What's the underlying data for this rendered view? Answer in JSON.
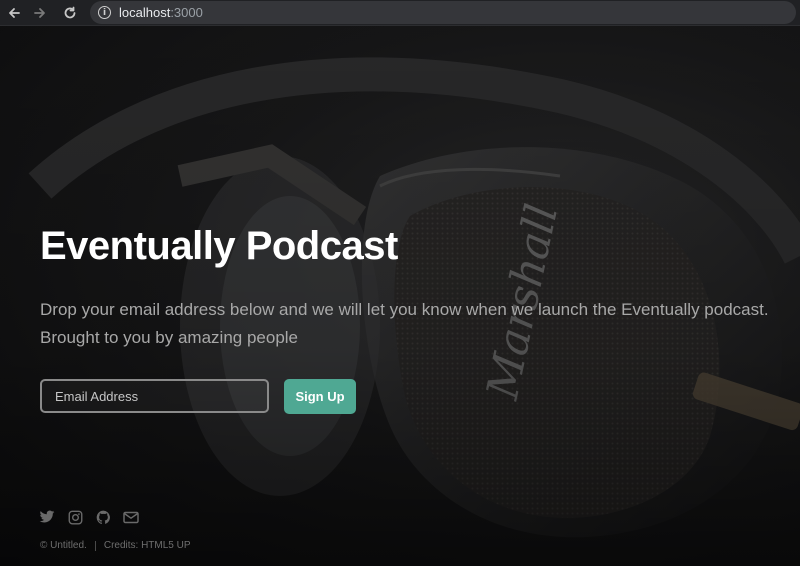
{
  "browser": {
    "url_host": "localhost",
    "url_port": ":3000",
    "icons": [
      "back-arrow-icon",
      "forward-arrow-icon",
      "reload-icon",
      "info-icon"
    ]
  },
  "hero": {
    "title": "Eventually Podcast",
    "description": "Drop your email address below and we will let you know when we launch the Eventually podcast. Brought to you by amazing people"
  },
  "signup": {
    "email_placeholder": "Email Address",
    "email_value": "",
    "button_label": "Sign Up",
    "button_color": "#4fa893"
  },
  "social": {
    "icons": [
      "twitter-icon",
      "instagram-icon",
      "github-icon",
      "email-icon"
    ]
  },
  "footer": {
    "copyright": "© Untitled.",
    "credits_prefix": "Credits: ",
    "credits_link": "HTML5 UP"
  }
}
